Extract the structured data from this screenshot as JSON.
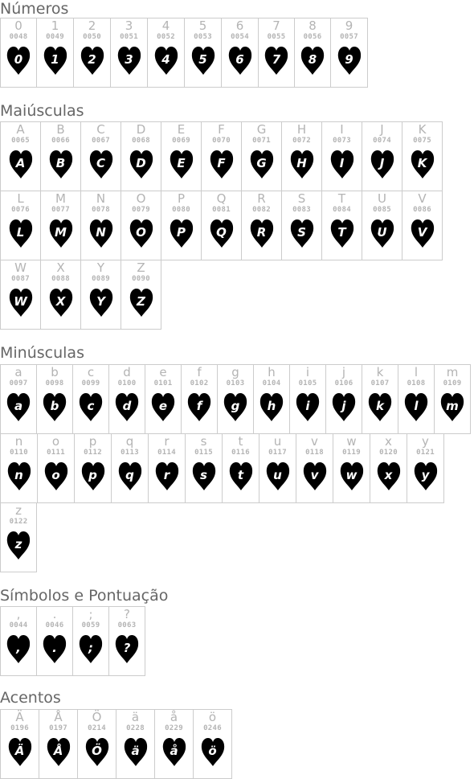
{
  "sections": [
    {
      "title": "Números",
      "rows": [
        [
          {
            "char": "0",
            "code": "0048"
          },
          {
            "char": "1",
            "code": "0049"
          },
          {
            "char": "2",
            "code": "0050"
          },
          {
            "char": "3",
            "code": "0051"
          },
          {
            "char": "4",
            "code": "0052"
          },
          {
            "char": "5",
            "code": "0053"
          },
          {
            "char": "6",
            "code": "0054"
          },
          {
            "char": "7",
            "code": "0055"
          },
          {
            "char": "8",
            "code": "0056"
          },
          {
            "char": "9",
            "code": "0057"
          }
        ]
      ]
    },
    {
      "title": "Maiúsculas",
      "rows": [
        [
          {
            "char": "A",
            "code": "0065"
          },
          {
            "char": "B",
            "code": "0066"
          },
          {
            "char": "C",
            "code": "0067"
          },
          {
            "char": "D",
            "code": "0068"
          },
          {
            "char": "E",
            "code": "0069"
          },
          {
            "char": "F",
            "code": "0070"
          },
          {
            "char": "G",
            "code": "0071"
          },
          {
            "char": "H",
            "code": "0072"
          },
          {
            "char": "I",
            "code": "0073"
          },
          {
            "char": "J",
            "code": "0074"
          },
          {
            "char": "K",
            "code": "0075"
          }
        ],
        [
          {
            "char": "L",
            "code": "0076"
          },
          {
            "char": "M",
            "code": "0077"
          },
          {
            "char": "N",
            "code": "0078"
          },
          {
            "char": "O",
            "code": "0079"
          },
          {
            "char": "P",
            "code": "0080"
          },
          {
            "char": "Q",
            "code": "0081"
          },
          {
            "char": "R",
            "code": "0082"
          },
          {
            "char": "S",
            "code": "0083"
          },
          {
            "char": "T",
            "code": "0084"
          },
          {
            "char": "U",
            "code": "0085"
          },
          {
            "char": "V",
            "code": "0086"
          }
        ],
        [
          {
            "char": "W",
            "code": "0087"
          },
          {
            "char": "X",
            "code": "0088"
          },
          {
            "char": "Y",
            "code": "0089"
          },
          {
            "char": "Z",
            "code": "0090"
          }
        ]
      ]
    },
    {
      "title": "Minúsculas",
      "rows": [
        [
          {
            "char": "a",
            "code": "0097"
          },
          {
            "char": "b",
            "code": "0098"
          },
          {
            "char": "c",
            "code": "0099"
          },
          {
            "char": "d",
            "code": "0100"
          },
          {
            "char": "e",
            "code": "0101"
          },
          {
            "char": "f",
            "code": "0102"
          },
          {
            "char": "g",
            "code": "0103"
          },
          {
            "char": "h",
            "code": "0104"
          },
          {
            "char": "i",
            "code": "0105"
          },
          {
            "char": "j",
            "code": "0106"
          },
          {
            "char": "k",
            "code": "0107"
          },
          {
            "char": "l",
            "code": "0108"
          },
          {
            "char": "m",
            "code": "0109"
          }
        ],
        [
          {
            "char": "n",
            "code": "0110"
          },
          {
            "char": "o",
            "code": "0111"
          },
          {
            "char": "p",
            "code": "0112"
          },
          {
            "char": "q",
            "code": "0113"
          },
          {
            "char": "r",
            "code": "0114"
          },
          {
            "char": "s",
            "code": "0115"
          },
          {
            "char": "t",
            "code": "0116"
          },
          {
            "char": "u",
            "code": "0117"
          },
          {
            "char": "v",
            "code": "0118"
          },
          {
            "char": "w",
            "code": "0119"
          },
          {
            "char": "x",
            "code": "0120"
          },
          {
            "char": "y",
            "code": "0121"
          }
        ],
        [
          {
            "char": "z",
            "code": "0122"
          }
        ]
      ]
    },
    {
      "title": "Símbolos e Pontuação",
      "rows": [
        [
          {
            "char": ",",
            "code": "0044"
          },
          {
            "char": ".",
            "code": "0046"
          },
          {
            "char": ";",
            "code": "0059"
          },
          {
            "char": "?",
            "code": "0063"
          }
        ]
      ]
    },
    {
      "title": "Acentos",
      "rows": [
        [
          {
            "char": "Ä",
            "code": "0196"
          },
          {
            "char": "Å",
            "code": "0197"
          },
          {
            "char": "Ö",
            "code": "0214"
          },
          {
            "char": "ä",
            "code": "0228"
          },
          {
            "char": "å",
            "code": "0229"
          },
          {
            "char": "ö",
            "code": "0246"
          }
        ]
      ]
    }
  ],
  "colors": {
    "title": "#666666",
    "label": "#b4b4b4",
    "border": "#cccccc",
    "heart": "#000000",
    "glyph": "#ffffff"
  },
  "icon": "heart-icon"
}
